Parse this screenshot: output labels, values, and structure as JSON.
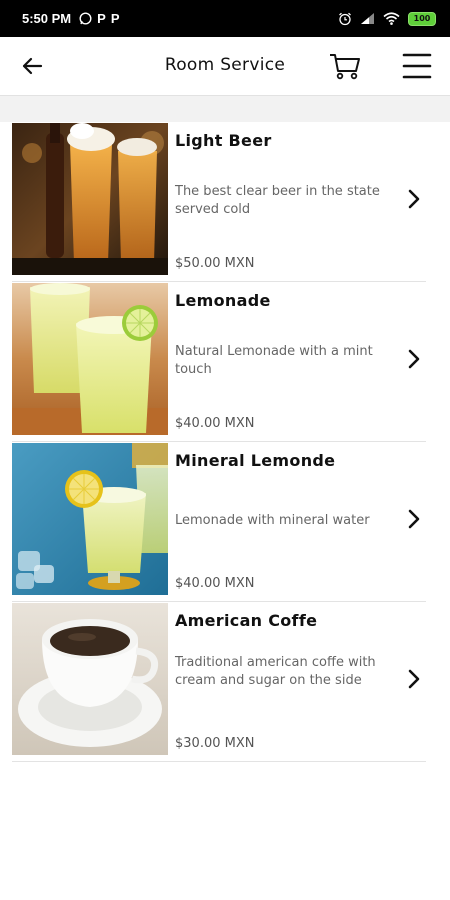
{
  "status_bar": {
    "time": "5:50 PM",
    "notification_icons": [
      "whatsapp-icon",
      "p-app-icon",
      "p-app-icon"
    ],
    "p_glyph": "P",
    "battery_label": "100",
    "system_icons": [
      "alarm-icon",
      "signal-icon",
      "wifi-icon",
      "battery-icon"
    ]
  },
  "appbar": {
    "title": "Room Service",
    "icons": [
      "back-arrow-icon",
      "cart-icon",
      "menu-icon"
    ]
  },
  "products": [
    {
      "name": "Light Beer",
      "description": "The best clear beer in the state served cold",
      "price": "$50.00 MXN"
    },
    {
      "name": "Lemonade",
      "description": "Natural Lemonade with a mint touch",
      "price": "$40.00 MXN"
    },
    {
      "name": "Mineral Lemonde",
      "description": "Lemonade with mineral water",
      "price": "$40.00 MXN"
    },
    {
      "name": "American Coffe",
      "description": "Traditional american coffe with cream and sugar on the side",
      "price": "$30.00 MXN"
    }
  ],
  "colors": {
    "status_bar": "#000000",
    "battery": "#5fcf3a",
    "divider": "#e3e3e3",
    "gap": "#f2f2f2"
  }
}
